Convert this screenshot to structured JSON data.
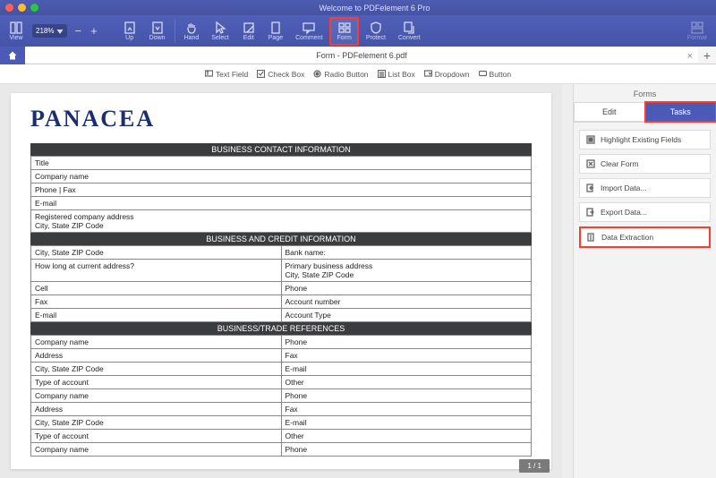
{
  "window": {
    "title": "Welcome to PDFelement 6 Pro"
  },
  "toolbar": {
    "view": "View",
    "zoom": "Zoom",
    "zoom_level": "218%",
    "up": "Up",
    "down": "Down",
    "hand": "Hand",
    "select": "Select",
    "edit": "Edit",
    "page": "Page",
    "comment": "Comment",
    "form": "Form",
    "protect": "Protect",
    "convert": "Convert",
    "format": "Format"
  },
  "tabs": {
    "doc_title": "Form - PDFelement 6.pdf"
  },
  "formbar": {
    "text_field": "Text Field",
    "check_box": "Check Box",
    "radio_button": "Radio Button",
    "list_box": "List Box",
    "dropdown": "Dropdown",
    "button": "Button"
  },
  "document": {
    "logo": "PANACEA",
    "sections": {
      "s1": "BUSINESS CONTACT INFORMATION",
      "s2": "BUSINESS AND CREDIT INFORMATION",
      "s3": "BUSINESS/TRADE REFERENCES"
    },
    "rows1": [
      "Title",
      "Company name",
      "Phone | Fax",
      "E-mail",
      "Registered company address\nCity, State ZIP Code"
    ],
    "rows2": [
      [
        "City, State ZIP Code",
        "Bank name:"
      ],
      [
        "How long at current address?",
        "Primary business address\nCity, State ZIP Code"
      ],
      [
        "Cell",
        "Phone"
      ],
      [
        "Fax",
        "Account number"
      ],
      [
        "E-mail",
        "Account Type"
      ]
    ],
    "rows3": [
      [
        "Company name",
        "Phone"
      ],
      [
        "Address",
        "Fax"
      ],
      [
        "City, State ZIP Code",
        "E-mail"
      ],
      [
        "Type of account",
        "Other"
      ],
      [
        "Company name",
        "Phone"
      ],
      [
        "Address",
        "Fax"
      ],
      [
        "City, State ZIP Code",
        "E-mail"
      ],
      [
        "Type of account",
        "Other"
      ],
      [
        "Company name",
        "Phone"
      ]
    ],
    "page_indicator": "1 / 1"
  },
  "sidepanel": {
    "title": "Forms",
    "tab_edit": "Edit",
    "tab_tasks": "Tasks",
    "items": {
      "highlight": "Highlight Existing Fields",
      "clear": "Clear Form",
      "import": "Import Data...",
      "export": "Export Data...",
      "extract": "Data Extraction"
    }
  }
}
